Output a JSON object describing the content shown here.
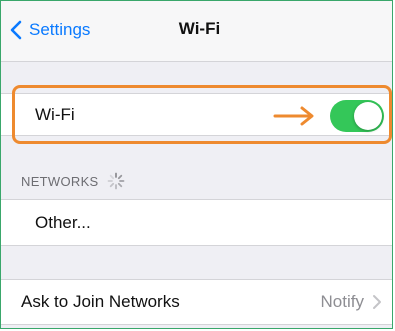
{
  "navbar": {
    "back_label": "Settings",
    "title": "Wi-Fi"
  },
  "wifi": {
    "label": "Wi-Fi",
    "enabled": true,
    "toggle_color": "#34c759"
  },
  "networks": {
    "header": "NETWORKS",
    "other_label": "Other..."
  },
  "ask_to_join": {
    "label": "Ask to Join Networks",
    "value": "Notify"
  },
  "colors": {
    "accent": "#0a7aff",
    "highlight": "#ee8a2f",
    "frame_border": "#3aa76b"
  },
  "icons": [
    "chevron-left-icon",
    "arrow-right-icon",
    "spinner-icon",
    "chevron-right-icon"
  ]
}
